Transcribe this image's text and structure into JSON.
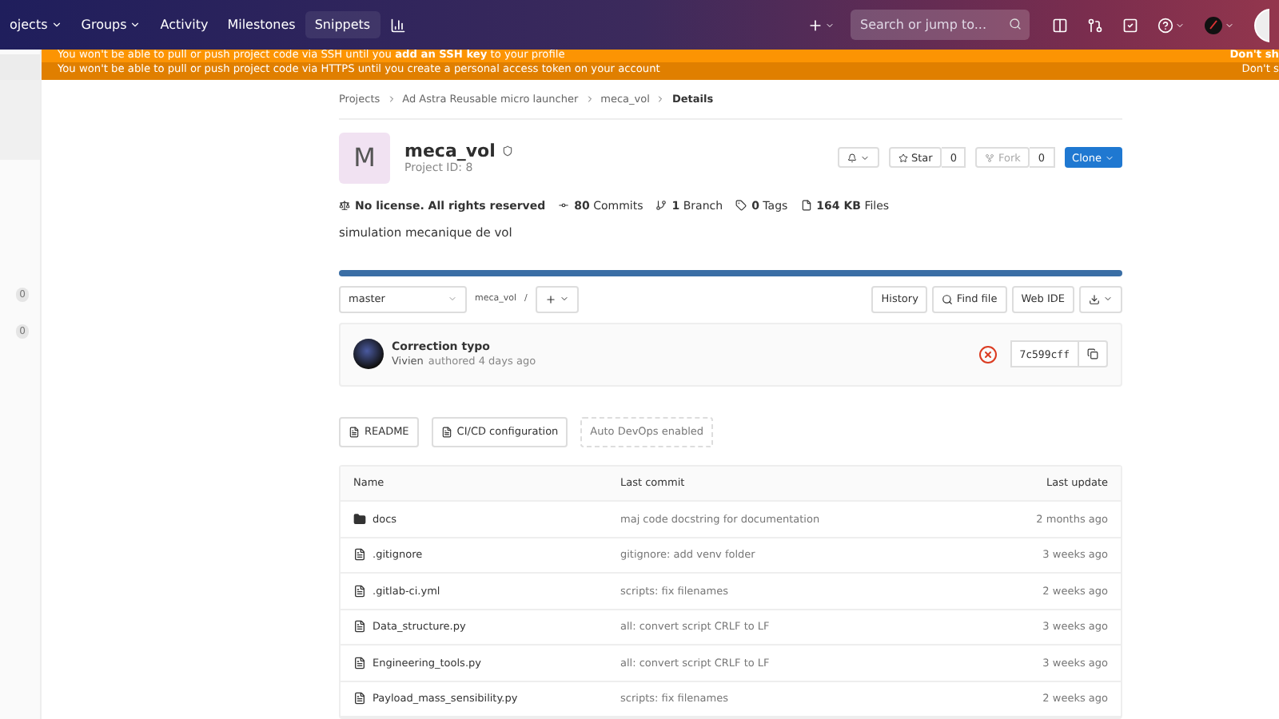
{
  "navbar": {
    "items": [
      {
        "label": "ojects",
        "caret": true,
        "selected": false
      },
      {
        "label": "Groups",
        "caret": true,
        "selected": false
      },
      {
        "label": "Activity",
        "caret": false,
        "selected": false
      },
      {
        "label": "Milestones",
        "caret": false,
        "selected": false
      },
      {
        "label": "Snippets",
        "caret": false,
        "selected": true
      }
    ],
    "search": {
      "placeholder": "Search or jump to..."
    }
  },
  "sidebar": {
    "badges": [
      "0",
      "0"
    ]
  },
  "banners": [
    {
      "text": "You won't be able to pull or push project code via SSH until you **add an SSH key** to your profile",
      "dismiss": "Don't sh"
    },
    {
      "text": "You won't be able to pull or push project code via HTTPS until you create a personal access token on your account",
      "dismiss": "Don't s"
    }
  ],
  "breadcrumbs": [
    "Projects",
    "Ad Astra Reusable micro launcher",
    "meca_vol",
    "Details"
  ],
  "project": {
    "avatar_letter": "M",
    "name": "meca_vol",
    "id_text": "Project ID: 8"
  },
  "actions": {
    "star": {
      "label": "Star",
      "count": "0"
    },
    "fork": {
      "label": "Fork",
      "count": "0",
      "disabled": true
    },
    "clone": "Clone"
  },
  "stats": [
    {
      "kind": "license",
      "text": "**No license. All rights reserved**"
    },
    {
      "kind": "commits",
      "text": "**80** Commits"
    },
    {
      "kind": "branch",
      "text": "**1** Branch"
    },
    {
      "kind": "tags",
      "text": "**0** Tags"
    },
    {
      "kind": "files",
      "text": "**164 KB** Files"
    }
  ],
  "description": "simulation mecanique de vol",
  "repo_bar": {
    "branch": "master",
    "path": "meca_vol",
    "separator": "/",
    "buttons": [
      "History",
      "Find file",
      "Web IDE"
    ]
  },
  "commit": {
    "title": "Correction typo",
    "author": "Vivien",
    "meta": "authored 4 days ago",
    "failed": true,
    "sha": "7c599cff"
  },
  "quick_links": [
    {
      "label": "README",
      "kind": "file"
    },
    {
      "label": "CI/CD configuration",
      "kind": "file"
    },
    {
      "label": "Auto DevOps enabled",
      "kind": "dashed"
    }
  ],
  "table": {
    "columns": [
      "Name",
      "Last commit",
      "Last update"
    ],
    "rows": [
      {
        "kind": "folder",
        "name": "docs",
        "commit": "maj code docstring for documentation",
        "updated": "2 months ago"
      },
      {
        "kind": "file",
        "name": ".gitignore",
        "commit": "gitignore: add venv folder",
        "updated": "3 weeks ago"
      },
      {
        "kind": "file",
        "name": ".gitlab-ci.yml",
        "commit": "scripts: fix filenames",
        "updated": "2 weeks ago"
      },
      {
        "kind": "file",
        "name": "Data_structure.py",
        "commit": "all: convert script CRLF to LF",
        "updated": "3 weeks ago"
      },
      {
        "kind": "file",
        "name": "Engineering_tools.py",
        "commit": "all: convert script CRLF to LF",
        "updated": "3 weeks ago"
      },
      {
        "kind": "file",
        "name": "Payload_mass_sensibility.py",
        "commit": "scripts: fix filenames",
        "updated": "2 weeks ago"
      }
    ]
  }
}
